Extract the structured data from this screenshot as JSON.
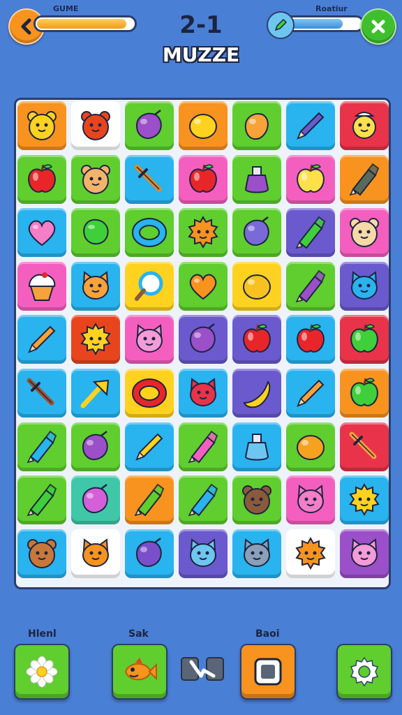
{
  "header": {
    "level": "2-1",
    "title": "MUZZE",
    "left_bar_label": "GUME",
    "right_bar_label": "Roatiur",
    "left_bar_fill": 0.93,
    "right_bar_fill": 0.78,
    "back_icon": "chevron-left-icon",
    "close_icon": "close-icon",
    "pencil_icon": "pencil-icon"
  },
  "board": {
    "columns": 7,
    "rows": 9,
    "tiles": [
      {
        "bg": "#f7931e",
        "icon": "bear-face",
        "fg": "#ffd21f"
      },
      {
        "bg": "#ffffff",
        "icon": "bear-face",
        "fg": "#e8451e"
      },
      {
        "bg": "#5fce2e",
        "icon": "plum",
        "fg": "#9b4fc9"
      },
      {
        "bg": "#f7931e",
        "icon": "lemon",
        "fg": "#ffd21f"
      },
      {
        "bg": "#5fce2e",
        "icon": "mango",
        "fg": "#f7a23a"
      },
      {
        "bg": "#29b3ef",
        "icon": "pencil",
        "fg": "#6a5acd"
      },
      {
        "bg": "#e8334a",
        "icon": "cake-face",
        "fg": "#ffe04a"
      },
      {
        "bg": "#5fce2e",
        "icon": "apple",
        "fg": "#e8262a"
      },
      {
        "bg": "#5fce2e",
        "icon": "bear-face",
        "fg": "#f2b36b"
      },
      {
        "bg": "#29b3ef",
        "icon": "sword",
        "fg": "#e08a2a"
      },
      {
        "bg": "#f45fbf",
        "icon": "apple",
        "fg": "#e8262a"
      },
      {
        "bg": "#5fce2e",
        "icon": "potion",
        "fg": "#9b4fc9"
      },
      {
        "bg": "#f45fbf",
        "icon": "apple",
        "fg": "#ffe04a"
      },
      {
        "bg": "#f7931e",
        "icon": "crayon",
        "fg": "#5a6a5a"
      },
      {
        "bg": "#29b3ef",
        "icon": "heart",
        "fg": "#f47ec8"
      },
      {
        "bg": "#5fce2e",
        "icon": "blob",
        "fg": "#3fcf3a"
      },
      {
        "bg": "#5fce2e",
        "icon": "ring",
        "fg": "#29b3ef"
      },
      {
        "bg": "#5fce2e",
        "icon": "sun-face",
        "fg": "#f7931e"
      },
      {
        "bg": "#5fce2e",
        "icon": "plum",
        "fg": "#7a6ad8"
      },
      {
        "bg": "#6a5acd",
        "icon": "crayon",
        "fg": "#3fcf3a"
      },
      {
        "bg": "#f45fbf",
        "icon": "bear-face",
        "fg": "#f7d9a8"
      },
      {
        "bg": "#f45fbf",
        "icon": "cupcake",
        "fg": "#f7a23a"
      },
      {
        "bg": "#29b3ef",
        "icon": "cat-face",
        "fg": "#f7a23a"
      },
      {
        "bg": "#ffd21f",
        "icon": "magnifier",
        "fg": "#29b3ef"
      },
      {
        "bg": "#5fce2e",
        "icon": "heart",
        "fg": "#f7931e"
      },
      {
        "bg": "#ffd21f",
        "icon": "lemon",
        "fg": "#f7c21f"
      },
      {
        "bg": "#5fce2e",
        "icon": "crayon",
        "fg": "#9b4fc9"
      },
      {
        "bg": "#6a5acd",
        "icon": "cat-face",
        "fg": "#29b3ef"
      },
      {
        "bg": "#29b3ef",
        "icon": "pencil",
        "fg": "#f7a23a"
      },
      {
        "bg": "#e8451e",
        "icon": "sun-face",
        "fg": "#ffd21f"
      },
      {
        "bg": "#f45fbf",
        "icon": "cat-face",
        "fg": "#f49bd8"
      },
      {
        "bg": "#6a5acd",
        "icon": "plum",
        "fg": "#9b4fc9"
      },
      {
        "bg": "#6a5acd",
        "icon": "apple",
        "fg": "#e8262a"
      },
      {
        "bg": "#29b3ef",
        "icon": "apple",
        "fg": "#e8262a"
      },
      {
        "bg": "#e8334a",
        "icon": "apple",
        "fg": "#3fcf3a"
      },
      {
        "bg": "#29b3ef",
        "icon": "sword",
        "fg": "#a0522d"
      },
      {
        "bg": "#29b3ef",
        "icon": "arrow",
        "fg": "#ffd21f"
      },
      {
        "bg": "#ffd21f",
        "icon": "ring",
        "fg": "#e8262a"
      },
      {
        "bg": "#29b3ef",
        "icon": "cat-face",
        "fg": "#e8334a"
      },
      {
        "bg": "#6a5acd",
        "icon": "banana",
        "fg": "#ffd21f"
      },
      {
        "bg": "#29b3ef",
        "icon": "pencil",
        "fg": "#f7a23a"
      },
      {
        "bg": "#f7931e",
        "icon": "apple",
        "fg": "#3fcf3a"
      },
      {
        "bg": "#5fce2e",
        "icon": "crayon",
        "fg": "#29b3ef"
      },
      {
        "bg": "#5fce2e",
        "icon": "plum",
        "fg": "#9b4fc9"
      },
      {
        "bg": "#29b3ef",
        "icon": "pencil",
        "fg": "#ffd21f"
      },
      {
        "bg": "#5fce2e",
        "icon": "crayon",
        "fg": "#f45fbf"
      },
      {
        "bg": "#29b3ef",
        "icon": "potion",
        "fg": "#6ec6f0"
      },
      {
        "bg": "#5fce2e",
        "icon": "lemon",
        "fg": "#f7a21f"
      },
      {
        "bg": "#e8334a",
        "icon": "sword",
        "fg": "#f7a23a"
      },
      {
        "bg": "#5fce2e",
        "icon": "crayon",
        "fg": "#3fcf3a"
      },
      {
        "bg": "#3fc7a8",
        "icon": "plum",
        "fg": "#d45fd8"
      },
      {
        "bg": "#f7931e",
        "icon": "crayon",
        "fg": "#5fce2e"
      },
      {
        "bg": "#5fce2e",
        "icon": "crayon",
        "fg": "#29b3ef"
      },
      {
        "bg": "#5fce2e",
        "icon": "bear-face",
        "fg": "#8a5a3c"
      },
      {
        "bg": "#f45fbf",
        "icon": "cat-face",
        "fg": "#f47ec8"
      },
      {
        "bg": "#29b3ef",
        "icon": "sun-face",
        "fg": "#ffd21f"
      },
      {
        "bg": "#29b3ef",
        "icon": "bear-face",
        "fg": "#c8783a"
      },
      {
        "bg": "#ffffff",
        "icon": "cat-face",
        "fg": "#f7931e"
      },
      {
        "bg": "#29b3ef",
        "icon": "plum",
        "fg": "#7a4fc9"
      },
      {
        "bg": "#6a5acd",
        "icon": "cat-face",
        "fg": "#6ec6f0"
      },
      {
        "bg": "#29b3ef",
        "icon": "cat-face",
        "fg": "#8aa0b8"
      },
      {
        "bg": "#ffffff",
        "icon": "sun-face",
        "fg": "#f7931e"
      },
      {
        "bg": "#9b4fc9",
        "icon": "cat-face",
        "fg": "#f49bd8"
      }
    ]
  },
  "toolbar": {
    "hint_label": "Hlenl",
    "shop_label": "Sak",
    "reset_label": "Baoi",
    "hint_icon": "flower-icon",
    "shop_icon": "fish-icon",
    "swap_icon": "swap-icon",
    "stop_icon": "stop-icon",
    "settings_icon": "gear-icon",
    "colors": {
      "hint": "#5fce2e",
      "shop": "#5fce2e",
      "reset": "#f7931e",
      "settings": "#5fce2e"
    }
  }
}
